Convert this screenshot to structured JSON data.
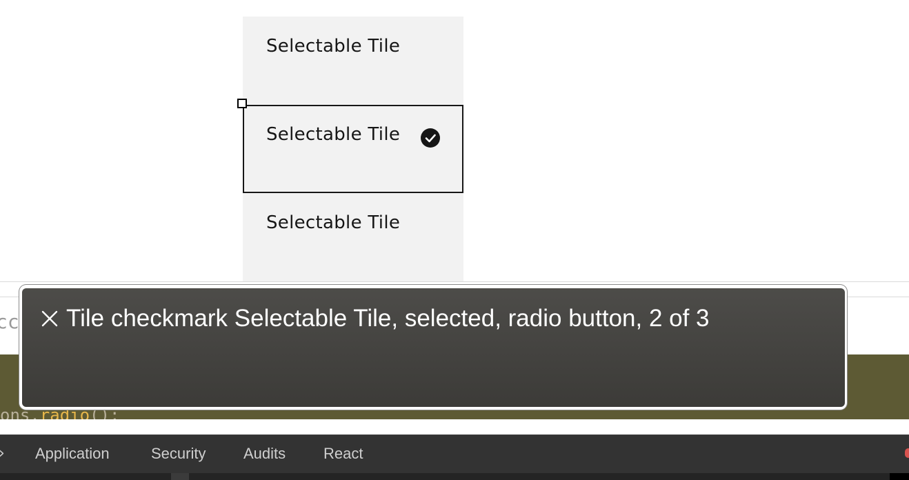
{
  "tiles": [
    {
      "label": "Selectable Tile",
      "selected": false
    },
    {
      "label": "Selectable Tile",
      "selected": true
    },
    {
      "label": "Selectable Tile",
      "selected": false
    }
  ],
  "voiceover": {
    "caption": "Tile checkmark Selectable Tile, selected, radio button, 2 of 3"
  },
  "console": {
    "partial_prompt_text": "cc",
    "code_prefix": "ons.",
    "code_fn": "radio",
    "code_suffix": "();"
  },
  "devtools": {
    "chevron": "›",
    "tabs": [
      {
        "label": "Application"
      },
      {
        "label": "Security"
      },
      {
        "label": "Audits"
      },
      {
        "label": "React"
      }
    ]
  },
  "colors": {
    "tile_bg": "#f2f2f2",
    "tile_text": "#161616",
    "caption_bg": "#4a4946",
    "olive_band": "#5d5a34",
    "devtools_bar": "#333333"
  },
  "icons": {
    "check": "checkmark-filled-icon",
    "close": "close-icon"
  }
}
